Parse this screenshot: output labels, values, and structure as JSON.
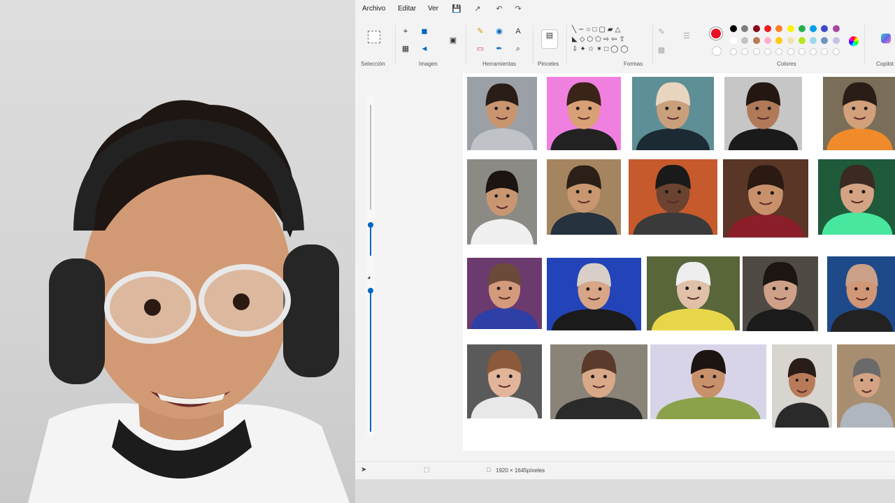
{
  "menu": {
    "file": "Archivo",
    "edit": "Editar",
    "view": "Ver"
  },
  "ribbon": {
    "groups": {
      "selection": "Selección",
      "image": "Imagen",
      "tools": "Herramientas",
      "brushes": "Pinceles",
      "shapes": "Formas",
      "colors": "Colores",
      "copilot": "Copilot"
    },
    "primary_color": "#e81123",
    "palette_row1": [
      "#000000",
      "#7f7f7f",
      "#880015",
      "#ed1c24",
      "#ff7f27",
      "#fff200",
      "#22b14c",
      "#00a2e8",
      "#3f48cc",
      "#a349a4"
    ],
    "palette_row2": [
      "#ffffff",
      "#c3c3c3",
      "#b97a57",
      "#ffaec9",
      "#ffc90e",
      "#efe4b0",
      "#b5e61d",
      "#99d9ea",
      "#7092be",
      "#c8bfe7"
    ]
  },
  "status": {
    "dimensions": "1920 × 1645píxeles"
  },
  "canvas": {
    "photos": [
      {
        "id": "r1c1",
        "bg": "#9aa0a6",
        "skin": "#c9956f",
        "hair": "#2a1d17",
        "shirt": "#bfc3c8"
      },
      {
        "id": "r1c2",
        "bg": "#f080e0",
        "skin": "#d9a077",
        "hair": "#3a2418",
        "shirt": "#222222"
      },
      {
        "id": "r1c3",
        "bg": "#5f8f96",
        "skin": "#caa07c",
        "hair": "#e8d5c0",
        "shirt": "#1c2a33"
      },
      {
        "id": "r1c4",
        "bg": "#c6c6c6",
        "skin": "#b07a58",
        "hair": "#241712",
        "shirt": "#1a1a1a"
      },
      {
        "id": "r1c5",
        "bg": "#7b6e58",
        "skin": "#d2a07a",
        "hair": "#2a1d17",
        "shirt": "#f08a2a"
      },
      {
        "id": "r2c1",
        "bg": "#8c8a85",
        "skin": "#c99672",
        "hair": "#1c1410",
        "shirt": "#f0f0f0"
      },
      {
        "id": "r2c2",
        "bg": "#a58560",
        "skin": "#c9976f",
        "hair": "#2b1f17",
        "shirt": "#26323e"
      },
      {
        "id": "r2c3",
        "bg": "#c75a2c",
        "skin": "#6b4330",
        "hair": "#1a1a1a",
        "shirt": "#3a3a3a"
      },
      {
        "id": "r2c4",
        "bg": "#5a3626",
        "skin": "#c9916b",
        "hair": "#2a1a12",
        "shirt": "#8a1f2a"
      },
      {
        "id": "r2c5",
        "bg": "#1f5a3a",
        "skin": "#d4a383",
        "hair": "#3a2a22",
        "shirt": "#49e6a0"
      },
      {
        "id": "r3c1",
        "bg": "#6b3a6e",
        "skin": "#d49a7c",
        "hair": "#6b4a3a",
        "shirt": "#2e3fa5"
      },
      {
        "id": "r3c2",
        "bg": "#2344b8",
        "skin": "#d8a586",
        "hair": "#d8d0c8",
        "shirt": "#1b1b1b"
      },
      {
        "id": "r3c3",
        "bg": "#58663a",
        "skin": "#e0c0a8",
        "hair": "#eeeeee",
        "shirt": "#e8d64a"
      },
      {
        "id": "r3c4",
        "bg": "#4f4a44",
        "skin": "#cfa088",
        "hair": "#1c1512",
        "shirt": "#1b1b1b"
      },
      {
        "id": "r3c5",
        "bg": "#1f4a8a",
        "skin": "#d09676",
        "hair": "#caa088",
        "shirt": "#222222"
      },
      {
        "id": "r4c1",
        "bg": "#5a5a5a",
        "skin": "#e2b49a",
        "hair": "#8a5a3a",
        "shirt": "#e8e8e8"
      },
      {
        "id": "r4c2",
        "bg": "#8a8478",
        "skin": "#d8a888",
        "hair": "#5a3a2a",
        "shirt": "#2a2a2a"
      },
      {
        "id": "r4c3",
        "bg": "#d8d4e8",
        "skin": "#c9916b",
        "hair": "#1c1410",
        "shirt": "#8ca24a"
      },
      {
        "id": "r4c4",
        "bg": "#d8d4d0",
        "skin": "#b87a58",
        "hair": "#2a1d17",
        "shirt": "#2a2a2a"
      },
      {
        "id": "r4c5",
        "bg": "#a88e70",
        "skin": "#d4a383",
        "hair": "#6a6a6a",
        "shirt": "#b0b6bd"
      }
    ]
  }
}
